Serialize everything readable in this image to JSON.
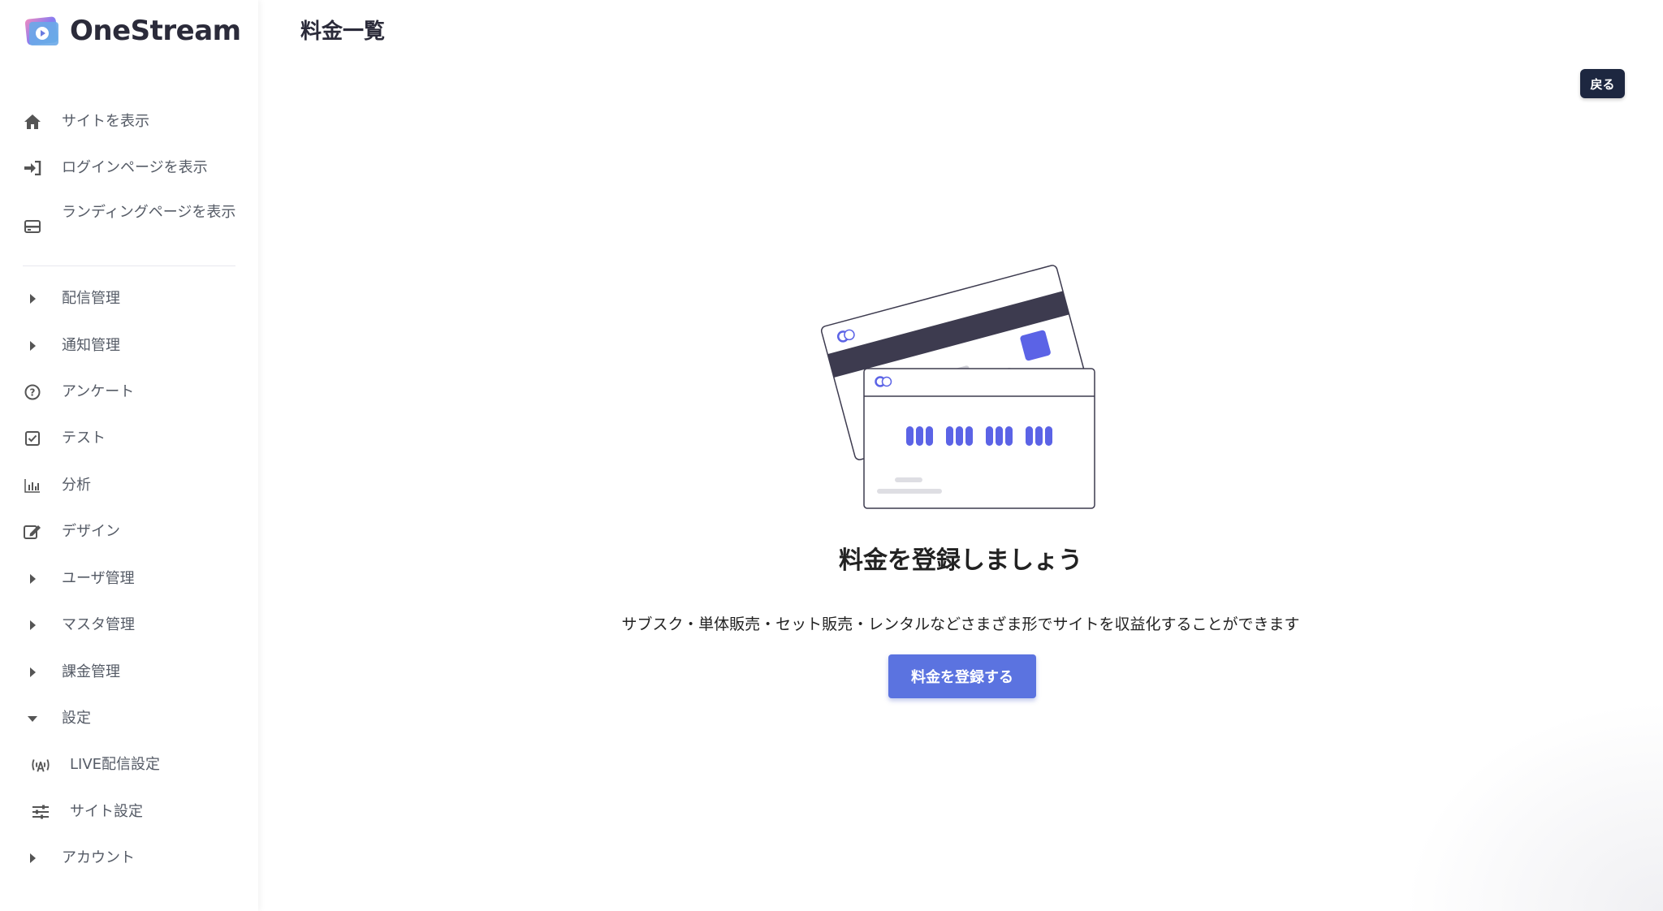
{
  "brand": {
    "name": "OneStream",
    "accent": "#5b73e0",
    "dark": "#1d2740"
  },
  "sidebar": {
    "items": [
      {
        "label": "サイトを表示",
        "icon": "home-icon"
      },
      {
        "label": "ログインページを表示",
        "icon": "sign-in-icon"
      },
      {
        "label": "ランディングページを表示",
        "icon": "landing-page-icon"
      },
      {
        "label": "配信管理",
        "icon": "caret-right-icon"
      },
      {
        "label": "通知管理",
        "icon": "caret-right-icon"
      },
      {
        "label": "アンケート",
        "icon": "question-circle-icon"
      },
      {
        "label": "テスト",
        "icon": "checkbox-icon"
      },
      {
        "label": "分析",
        "icon": "bar-chart-icon"
      },
      {
        "label": "デザイン",
        "icon": "edit-icon"
      },
      {
        "label": "ユーザ管理",
        "icon": "caret-right-icon"
      },
      {
        "label": "マスタ管理",
        "icon": "caret-right-icon"
      },
      {
        "label": "課金管理",
        "icon": "caret-right-icon"
      },
      {
        "label": "設定",
        "icon": "caret-down-icon"
      },
      {
        "label": "LIVE配信設定",
        "icon": "broadcast-icon"
      },
      {
        "label": "サイト設定",
        "icon": "sliders-icon"
      },
      {
        "label": "アカウント",
        "icon": "caret-right-icon"
      }
    ]
  },
  "header": {
    "title": "料金一覧",
    "back_label": "戻る"
  },
  "empty_state": {
    "title": "料金を登録しましょう",
    "description": "サブスク・単体販売・セット販売・レンタルなどさまざま形でサイトを収益化することができます",
    "cta_label": "料金を登録する"
  }
}
